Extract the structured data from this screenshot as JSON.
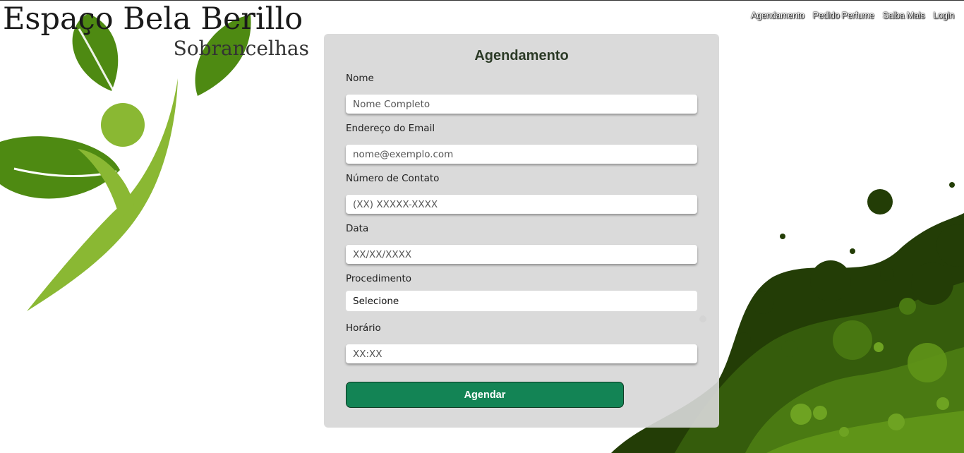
{
  "logo": {
    "title": "Espaço Bela Berillo",
    "subtitle": "Sobrancelhas"
  },
  "nav": {
    "items": [
      "Agendamento",
      "Pedido Perfume",
      "Saiba Mais",
      "Login"
    ]
  },
  "form": {
    "title": "Agendamento",
    "fields": [
      {
        "label": "Nome",
        "placeholder": "Nome Completo"
      },
      {
        "label": "Endereço do Email",
        "placeholder": "nome@exemplo.com"
      },
      {
        "label": "Número de Contato",
        "placeholder": "(XX) XXXXX-XXXX"
      },
      {
        "label": "Data",
        "placeholder": "XX/XX/XXXX"
      }
    ],
    "procedure": {
      "label": "Procedimento",
      "selected": "Selecione"
    },
    "time": {
      "label": "Horário",
      "placeholder": "XX:XX"
    },
    "submit_label": "Agendar"
  },
  "colors": {
    "accent": "#138455",
    "leaf_dark": "#4e8a12",
    "leaf_light": "#8ab833",
    "blob_dark": "#233d06"
  }
}
